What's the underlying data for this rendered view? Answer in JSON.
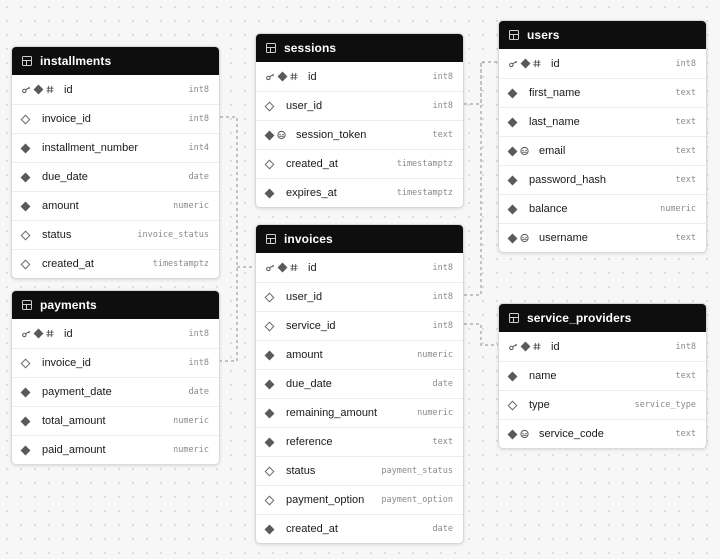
{
  "tables": {
    "installments": {
      "name": "installments",
      "columns": [
        {
          "name": "id",
          "type": "int8",
          "icons": [
            "key-icon",
            "not-null-icon",
            "identity-icon"
          ]
        },
        {
          "name": "invoice_id",
          "type": "int8",
          "icons": [
            "nullable-icon"
          ]
        },
        {
          "name": "installment_number",
          "type": "int4",
          "icons": [
            "not-null-icon"
          ]
        },
        {
          "name": "due_date",
          "type": "date",
          "icons": [
            "not-null-icon"
          ]
        },
        {
          "name": "amount",
          "type": "numeric",
          "icons": [
            "not-null-icon"
          ]
        },
        {
          "name": "status",
          "type": "invoice_status",
          "icons": [
            "nullable-icon"
          ]
        },
        {
          "name": "created_at",
          "type": "timestamptz",
          "icons": [
            "nullable-icon"
          ]
        }
      ]
    },
    "payments": {
      "name": "payments",
      "columns": [
        {
          "name": "id",
          "type": "int8",
          "icons": [
            "key-icon",
            "not-null-icon",
            "identity-icon"
          ]
        },
        {
          "name": "invoice_id",
          "type": "int8",
          "icons": [
            "nullable-icon"
          ]
        },
        {
          "name": "payment_date",
          "type": "date",
          "icons": [
            "not-null-icon"
          ]
        },
        {
          "name": "total_amount",
          "type": "numeric",
          "icons": [
            "not-null-icon"
          ]
        },
        {
          "name": "paid_amount",
          "type": "numeric",
          "icons": [
            "not-null-icon"
          ]
        }
      ]
    },
    "sessions": {
      "name": "sessions",
      "columns": [
        {
          "name": "id",
          "type": "int8",
          "icons": [
            "key-icon",
            "not-null-icon",
            "identity-icon"
          ]
        },
        {
          "name": "user_id",
          "type": "int8",
          "icons": [
            "nullable-icon"
          ]
        },
        {
          "name": "session_token",
          "type": "text",
          "icons": [
            "not-null-icon",
            "unique-icon"
          ]
        },
        {
          "name": "created_at",
          "type": "timestamptz",
          "icons": [
            "nullable-icon"
          ]
        },
        {
          "name": "expires_at",
          "type": "timestamptz",
          "icons": [
            "not-null-icon"
          ]
        }
      ]
    },
    "invoices": {
      "name": "invoices",
      "columns": [
        {
          "name": "id",
          "type": "int8",
          "icons": [
            "key-icon",
            "not-null-icon",
            "identity-icon"
          ]
        },
        {
          "name": "user_id",
          "type": "int8",
          "icons": [
            "nullable-icon"
          ]
        },
        {
          "name": "service_id",
          "type": "int8",
          "icons": [
            "nullable-icon"
          ]
        },
        {
          "name": "amount",
          "type": "numeric",
          "icons": [
            "not-null-icon"
          ]
        },
        {
          "name": "due_date",
          "type": "date",
          "icons": [
            "not-null-icon"
          ]
        },
        {
          "name": "remaining_amount",
          "type": "numeric",
          "icons": [
            "not-null-icon"
          ]
        },
        {
          "name": "reference",
          "type": "text",
          "icons": [
            "not-null-icon"
          ]
        },
        {
          "name": "status",
          "type": "payment_status",
          "icons": [
            "nullable-icon"
          ]
        },
        {
          "name": "payment_option",
          "type": "payment_option",
          "icons": [
            "nullable-icon"
          ]
        },
        {
          "name": "created_at",
          "type": "date",
          "icons": [
            "not-null-icon"
          ]
        }
      ]
    },
    "users": {
      "name": "users",
      "columns": [
        {
          "name": "id",
          "type": "int8",
          "icons": [
            "key-icon",
            "not-null-icon",
            "identity-icon"
          ]
        },
        {
          "name": "first_name",
          "type": "text",
          "icons": [
            "not-null-icon"
          ]
        },
        {
          "name": "last_name",
          "type": "text",
          "icons": [
            "not-null-icon"
          ]
        },
        {
          "name": "email",
          "type": "text",
          "icons": [
            "not-null-icon",
            "unique-icon"
          ]
        },
        {
          "name": "password_hash",
          "type": "text",
          "icons": [
            "not-null-icon"
          ]
        },
        {
          "name": "balance",
          "type": "numeric",
          "icons": [
            "not-null-icon"
          ]
        },
        {
          "name": "username",
          "type": "text",
          "icons": [
            "not-null-icon",
            "unique-icon"
          ]
        }
      ]
    },
    "service_providers": {
      "name": "service_providers",
      "columns": [
        {
          "name": "id",
          "type": "int8",
          "icons": [
            "key-icon",
            "not-null-icon",
            "identity-icon"
          ]
        },
        {
          "name": "name",
          "type": "text",
          "icons": [
            "not-null-icon"
          ]
        },
        {
          "name": "type",
          "type": "service_type",
          "icons": [
            "nullable-icon"
          ]
        },
        {
          "name": "service_code",
          "type": "text",
          "icons": [
            "not-null-icon",
            "unique-icon"
          ]
        }
      ]
    }
  },
  "colors": {
    "header_bg": "#0e0e0e",
    "connector": "#8c8c8c",
    "canvas_bg": "#f7f7f7"
  }
}
